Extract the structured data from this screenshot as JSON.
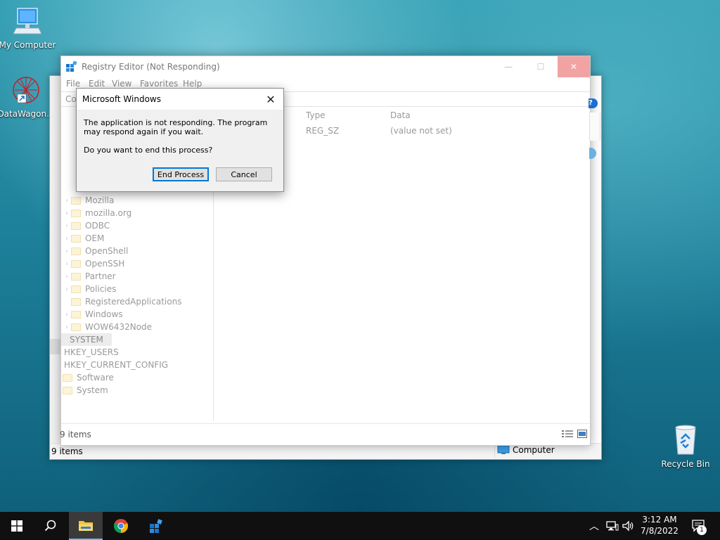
{
  "desktop": {
    "icons": [
      {
        "label": "My Computer"
      },
      {
        "label": "DataWagon..."
      },
      {
        "label": "Recycle Bin"
      }
    ]
  },
  "back_window": {
    "status_count": "9 items",
    "status_location": "Computer"
  },
  "regedit": {
    "title": "Registry Editor (Not Responding)",
    "menu": [
      "File",
      "Edit",
      "View",
      "Favorites",
      "Help"
    ],
    "address_fragment": "Co",
    "columns": {
      "type": "Type",
      "data": "Data"
    },
    "value_row": {
      "type": "REG_SZ",
      "data": "(value not set)"
    },
    "tree": [
      {
        "label": "Mozilla",
        "expandable": true
      },
      {
        "label": "mozilla.org",
        "expandable": true
      },
      {
        "label": "ODBC",
        "expandable": true
      },
      {
        "label": "OEM",
        "expandable": true
      },
      {
        "label": "OpenShell",
        "expandable": true
      },
      {
        "label": "OpenSSH",
        "expandable": true
      },
      {
        "label": "Partner",
        "expandable": true
      },
      {
        "label": "Policies",
        "expandable": true
      },
      {
        "label": "RegisteredApplications",
        "expandable": false
      },
      {
        "label": "Windows",
        "expandable": true
      },
      {
        "label": "WOW6432Node",
        "expandable": true
      },
      {
        "label": "SYSTEM",
        "expandable": false
      },
      {
        "label": "HKEY_USERS",
        "expandable": false
      },
      {
        "label": "HKEY_CURRENT_CONFIG",
        "expandable": false
      },
      {
        "label": "Software",
        "expandable": false
      },
      {
        "label": "System",
        "expandable": false
      }
    ],
    "status_count": "9 items"
  },
  "dialog": {
    "title": "Microsoft Windows",
    "message": "The application is not responding. The program may respond again if you wait.",
    "question": "Do you want to end this process?",
    "primary_label": "End Process",
    "secondary_label": "Cancel"
  },
  "taskbar": {
    "time": "3:12 AM",
    "date": "7/8/2022",
    "notification_count": "1"
  }
}
